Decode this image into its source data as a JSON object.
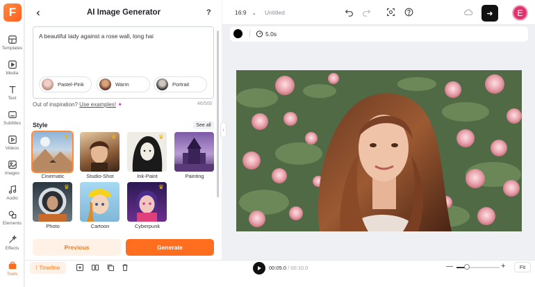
{
  "app": {
    "logo_letter": "F",
    "document_title": "Untitled"
  },
  "rail": {
    "items": [
      {
        "label": "Templates",
        "icon": "templates-icon"
      },
      {
        "label": "Media",
        "icon": "media-icon"
      },
      {
        "label": "Text",
        "icon": "text-icon"
      },
      {
        "label": "Subtitles",
        "icon": "subtitles-icon"
      },
      {
        "label": "Videos",
        "icon": "videos-icon"
      },
      {
        "label": "Images",
        "icon": "images-icon"
      },
      {
        "label": "Audio",
        "icon": "audio-icon"
      },
      {
        "label": "Elements",
        "icon": "elements-icon"
      },
      {
        "label": "Effects",
        "icon": "effects-icon"
      },
      {
        "label": "Tools",
        "icon": "tools-icon"
      }
    ]
  },
  "panel": {
    "title": "AI Image Generator",
    "help": "?",
    "prompt_value": "A beautiful lady against a rose wall, long hai",
    "chips": [
      {
        "label": "Pastel-Pink"
      },
      {
        "label": "Warm"
      },
      {
        "label": "Portrait"
      }
    ],
    "inspiration_text": "Out of inspiration?",
    "inspiration_link": "Use examples!",
    "char_count": "46/500",
    "style_heading": "Style",
    "see_all": "See all",
    "styles": [
      {
        "label": "Cinematic",
        "premium": true,
        "selected": true
      },
      {
        "label": "Studio-Shot",
        "premium": true
      },
      {
        "label": "Ink-Paint",
        "premium": true
      },
      {
        "label": "Painting",
        "premium": false
      },
      {
        "label": "Photo",
        "premium": true
      },
      {
        "label": "Cartoon",
        "premium": false
      },
      {
        "label": "Cyberpunk",
        "premium": true
      }
    ],
    "previous_label": "Previous",
    "generate_label": "Generate"
  },
  "topbar": {
    "ratio": "16:9"
  },
  "toolbar": {
    "duration": "5.0s",
    "color": "#000000"
  },
  "bottom": {
    "timeline_label": "Timeline",
    "current_time": "00:05.0",
    "total_time": "/ 00:10.0",
    "fit_label": "Fit",
    "zoom_level": 0.2
  },
  "colors": {
    "accent": "#ff6d1f",
    "accent_light": "#fff1e6"
  }
}
